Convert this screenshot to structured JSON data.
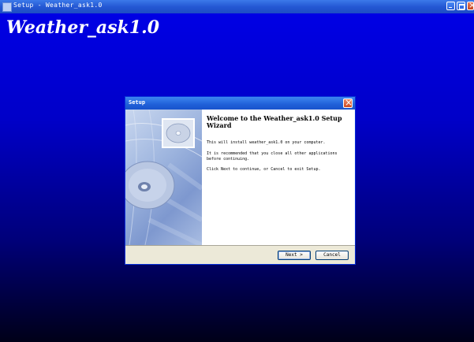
{
  "window": {
    "title": "Setup - Weather_ask1.0",
    "icons": [
      "setup-icon",
      "minimize-icon",
      "maximize-icon",
      "close-icon"
    ]
  },
  "background": {
    "app_title": "Weather_ask1.0",
    "colors": {
      "top": "#0000e8",
      "bottom": "#000018"
    }
  },
  "dialog": {
    "title": "Setup",
    "heading": "Welcome to the Weather_ask1.0 Setup Wizard",
    "paragraphs": [
      "This will install weather_ask1.0 on your computer.",
      "It is recommended that you close all other applications before continuing.",
      "Click Next to continue, or Cancel to exit Setup."
    ],
    "buttons": {
      "next": "Next >",
      "cancel": "Cancel"
    },
    "side_image": "cd-disc-illustration",
    "accent": "#0831d9"
  }
}
